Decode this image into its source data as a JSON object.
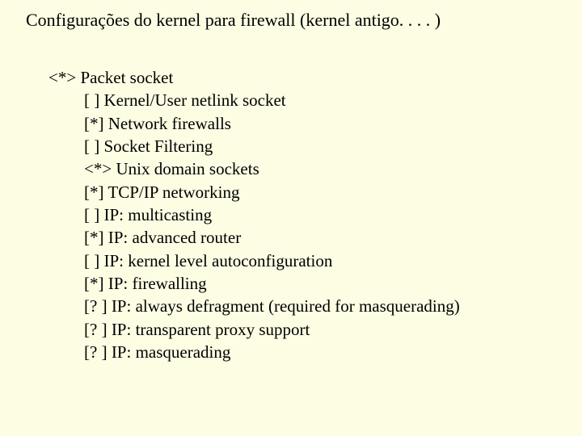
{
  "title": "Configurações do kernel para firewall (kernel antigo. . . . )",
  "options": [
    {
      "marker": "<*>",
      "label": "Packet socket",
      "indent": "top"
    },
    {
      "marker": "[ ]",
      "label": "Kernel/User netlink socket",
      "indent": "sub"
    },
    {
      "marker": "[*]",
      "label": "Network firewalls",
      "indent": "sub"
    },
    {
      "marker": "[ ]",
      "label": "Socket Filtering",
      "indent": "sub"
    },
    {
      "marker": "<*>",
      "label": "Unix domain sockets",
      "indent": "sub"
    },
    {
      "marker": "[*]",
      "label": "TCP/IP networking",
      "indent": "sub"
    },
    {
      "marker": "[ ]",
      "label": "IP: multicasting",
      "indent": "sub"
    },
    {
      "marker": "[*]",
      "label": "IP: advanced router",
      "indent": "sub"
    },
    {
      "marker": "[ ]",
      "label": "IP: kernel level autoconfiguration",
      "indent": "sub"
    },
    {
      "marker": "[*]",
      "label": "IP: firewalling",
      "indent": "sub"
    },
    {
      "marker": "[? ]",
      "label": "IP: always defragment (required for masquerading)",
      "indent": "sub"
    },
    {
      "marker": "[? ]",
      "label": "IP: transparent proxy support",
      "indent": "sub"
    },
    {
      "marker": "[? ]",
      "label": "IP: masquerading",
      "indent": "sub"
    }
  ]
}
